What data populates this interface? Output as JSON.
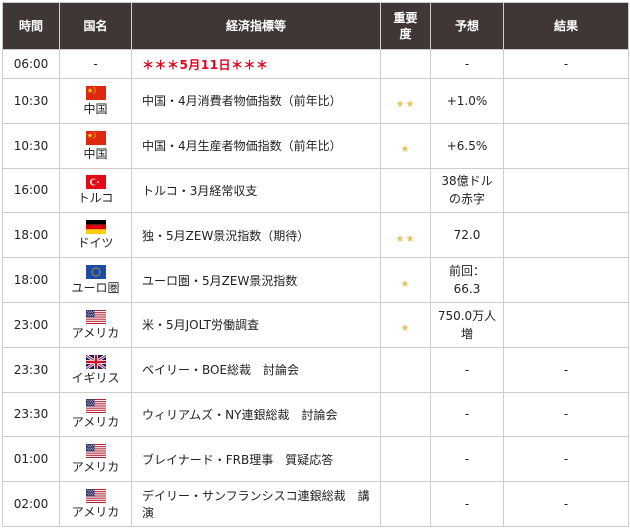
{
  "headers": {
    "time": "時間",
    "country": "国名",
    "indicator": "経済指標等",
    "importance_1": "重要",
    "importance_2": "度",
    "forecast": "予想",
    "result": "結果"
  },
  "colors": {
    "header_bg": "#3f3735",
    "special_text": "#e2001a",
    "star": "#e3c260"
  },
  "date_row": {
    "time": "06:00",
    "country": "-",
    "text": "＊＊＊5月11日＊＊＊",
    "importance": "",
    "forecast": "-",
    "result": "-"
  },
  "rows": [
    {
      "time": "10:30",
      "country": "中国",
      "flag": "china-flag",
      "event": "中国・4月消費者物価指数（前年比）",
      "stars": "★★",
      "forecast_1": "+1.0%",
      "forecast_2": "",
      "result": ""
    },
    {
      "time": "10:30",
      "country": "中国",
      "flag": "china-flag",
      "event": "中国・4月生産者物価指数（前年比）",
      "stars": "★",
      "forecast_1": "+6.5%",
      "forecast_2": "",
      "result": ""
    },
    {
      "time": "16:00",
      "country": "トルコ",
      "flag": "turkey-flag",
      "event": "トルコ・3月経常収支",
      "stars": "",
      "forecast_1": "38億ドル",
      "forecast_2": "の赤字",
      "result": ""
    },
    {
      "time": "18:00",
      "country": "ドイツ",
      "flag": "germany-flag",
      "event": "独・5月ZEW景況指数（期待）",
      "stars": "★★",
      "forecast_1": "72.0",
      "forecast_2": "",
      "result": ""
    },
    {
      "time": "18:00",
      "country": "ユーロ圏",
      "flag": "eu-flag",
      "event": "ユーロ圏・5月ZEW景況指数",
      "stars": "★",
      "forecast_1": "前回：",
      "forecast_2": "66.3",
      "result": ""
    },
    {
      "time": "23:00",
      "country": "アメリカ",
      "flag": "usa-flag",
      "event": "米・5月JOLT労働調査",
      "stars": "★",
      "forecast_1": "750.0万人",
      "forecast_2": "増",
      "result": ""
    },
    {
      "time": "23:30",
      "country": "イギリス",
      "flag": "uk-flag",
      "event": "ベイリー・BOE総裁　討論会",
      "stars": "",
      "forecast_1": "-",
      "forecast_2": "",
      "result": "-"
    },
    {
      "time": "23:30",
      "country": "アメリカ",
      "flag": "usa-flag",
      "event": "ウィリアムズ・NY連銀総裁　討論会",
      "stars": "",
      "forecast_1": "-",
      "forecast_2": "",
      "result": "-"
    },
    {
      "time": "01:00",
      "country": "アメリカ",
      "flag": "usa-flag",
      "event": "ブレイナード・FRB理事　質疑応答",
      "stars": "",
      "forecast_1": "-",
      "forecast_2": "",
      "result": "-"
    },
    {
      "time": "02:00",
      "country": "アメリカ",
      "flag": "usa-flag",
      "event": "デイリー・サンフランシスコ連銀総裁　講演",
      "stars": "",
      "forecast_1": "-",
      "forecast_2": "",
      "result": "-"
    }
  ]
}
